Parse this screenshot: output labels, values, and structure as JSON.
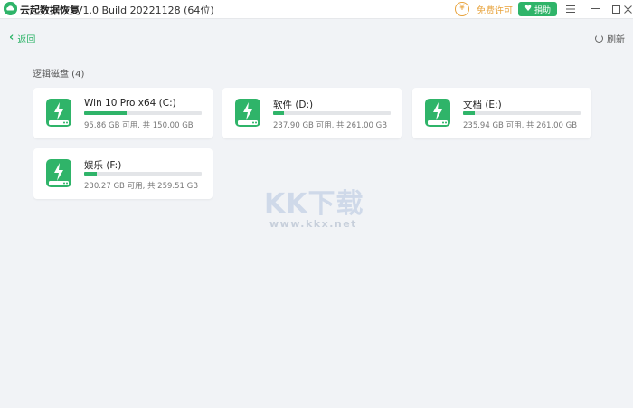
{
  "app": {
    "name": "云起数据恢复",
    "version": "V1.0 Build 20221128 (64位)"
  },
  "titlebar": {
    "free_license": "免费许可",
    "donate": "捐助"
  },
  "toolbar": {
    "back_label": "返回",
    "refresh_label": "刷新"
  },
  "section": {
    "title": "逻辑磁盘 (4)"
  },
  "drives": [
    {
      "name": "Win 10 Pro x64 (C:)",
      "size": "95.86 GB 可用, 共 150.00 GB",
      "used_fraction": 0.36
    },
    {
      "name": "软件 (D:)",
      "size": "237.90 GB 可用, 共 261.00 GB",
      "used_fraction": 0.09
    },
    {
      "name": "文档 (E:)",
      "size": "235.94 GB 可用, 共 261.00 GB",
      "used_fraction": 0.1
    },
    {
      "name": "娱乐 (F:)",
      "size": "230.27 GB 可用, 共 259.51 GB",
      "used_fraction": 0.11
    }
  ],
  "watermark": {
    "logo": "KK下载",
    "url": "www.kkx.net"
  },
  "colors": {
    "accent": "#2fb469",
    "license": "#e8a33c",
    "background": "#f1f3f6"
  },
  "icons": {
    "logo": "cloud-logo-icon",
    "drive": "hard-drive-icon",
    "back": "chevron-left-icon",
    "refresh": "refresh-icon"
  }
}
